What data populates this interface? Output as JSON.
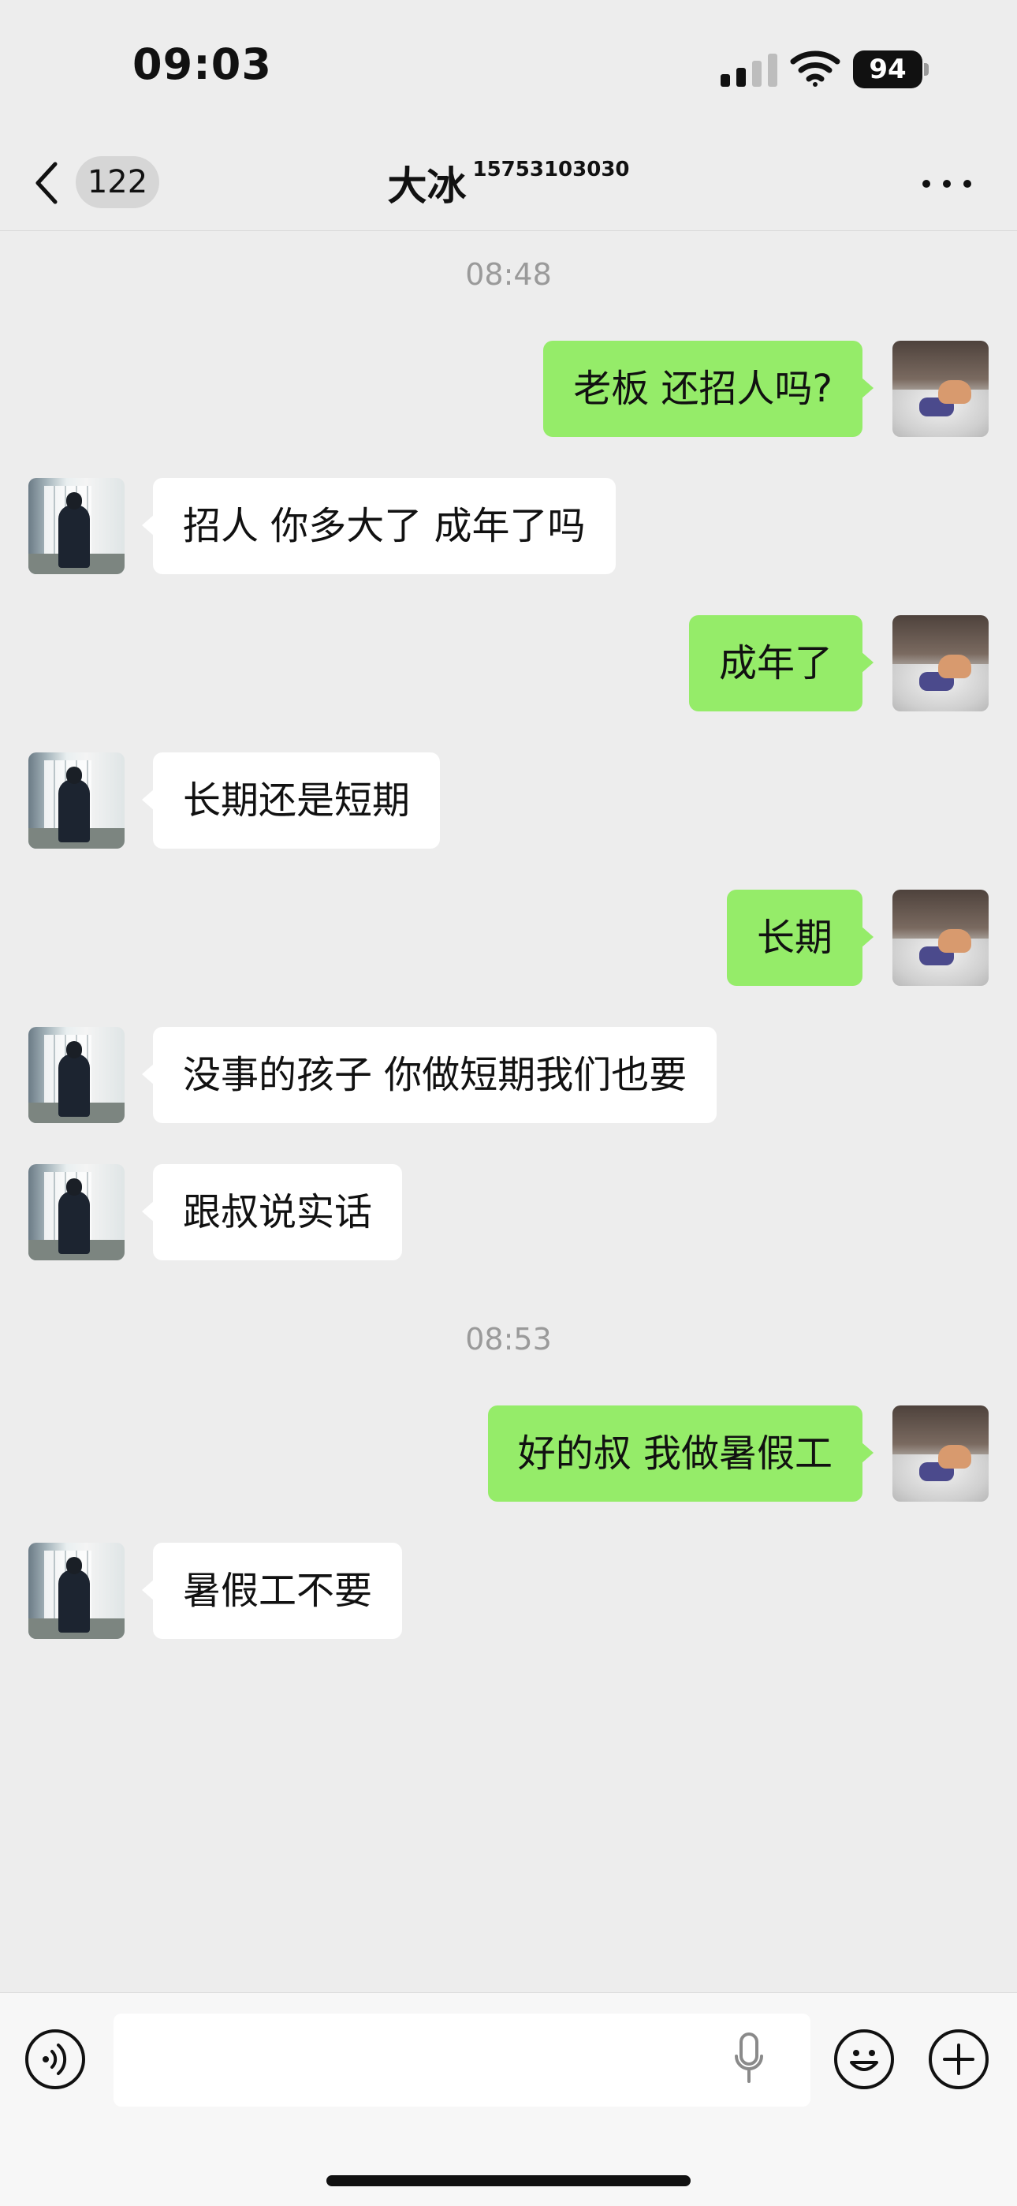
{
  "status_bar": {
    "time": "09:03",
    "battery": "94"
  },
  "header": {
    "back_badge": "122",
    "title": "大冰",
    "subtitle": "15753103030"
  },
  "timestamps": [
    "08:48",
    "08:53"
  ],
  "messages": [
    {
      "from": "me",
      "text": "老板 还招人吗?"
    },
    {
      "from": "other",
      "text": "招人 你多大了  成年了吗"
    },
    {
      "from": "me",
      "text": "成年了"
    },
    {
      "from": "other",
      "text": "长期还是短期"
    },
    {
      "from": "me",
      "text": "长期"
    },
    {
      "from": "other",
      "text": "没事的孩子 你做短期我们也要"
    },
    {
      "from": "other",
      "text": "跟叔说实话"
    },
    {
      "from": "me",
      "text": "好的叔 我做暑假工"
    },
    {
      "from": "other",
      "text": "暑假工不要"
    }
  ],
  "input": {
    "value": ""
  },
  "icons": [
    "back-arrow",
    "more-dots",
    "voice",
    "microphone",
    "emoji",
    "plus"
  ]
}
